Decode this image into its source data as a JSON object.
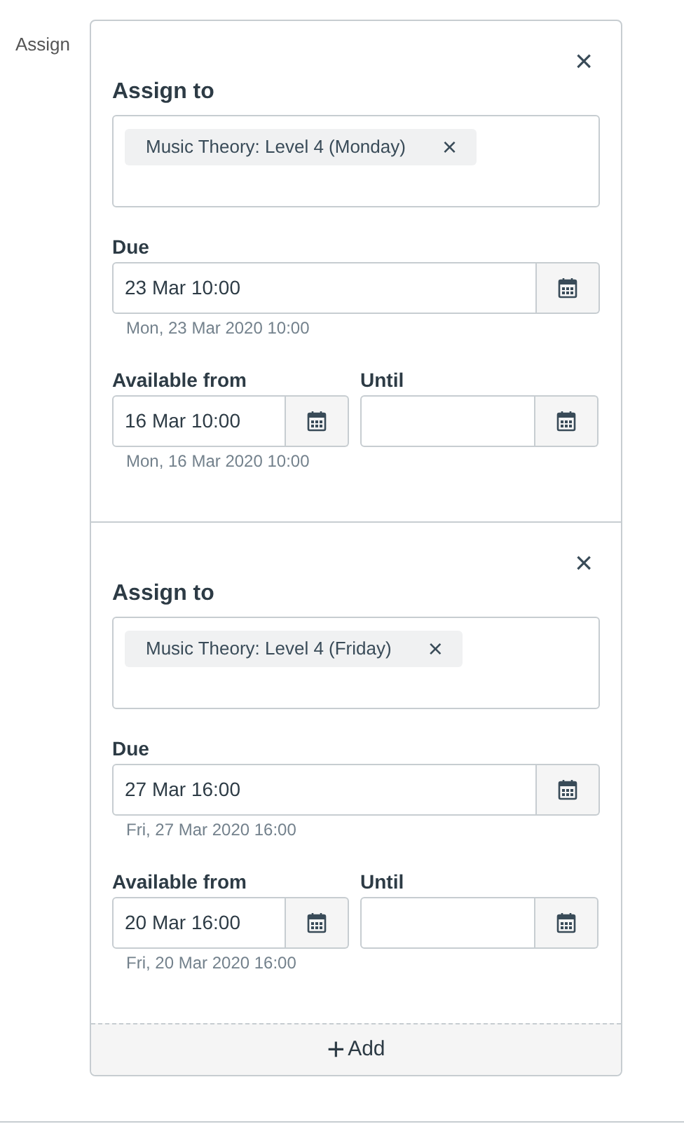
{
  "field_label": "Assign",
  "assignments": [
    {
      "close": "×",
      "title": "Assign to",
      "tokens": [
        {
          "label": "Music Theory: Level 4 (Monday)",
          "remove": "×"
        }
      ],
      "due": {
        "label": "Due",
        "value": "23 Mar 10:00",
        "hint": "Mon, 23 Mar 2020 10:00"
      },
      "available_from": {
        "label": "Available from",
        "value": "16 Mar 10:00",
        "hint": "Mon, 16 Mar 2020 10:00"
      },
      "until": {
        "label": "Until"
      }
    },
    {
      "close": "×",
      "title": "Assign to",
      "tokens": [
        {
          "label": "Music Theory: Level 4 (Friday)",
          "remove": "×"
        }
      ],
      "due": {
        "label": "Due",
        "value": "27 Mar 16:00",
        "hint": "Fri, 27 Mar 2020 16:00"
      },
      "available_from": {
        "label": "Available from",
        "value": "20 Mar 16:00",
        "hint": "Fri, 20 Mar 2020 16:00"
      },
      "until": {
        "label": "Until"
      }
    }
  ],
  "add_button": {
    "icon": "+",
    "label": "Add"
  }
}
